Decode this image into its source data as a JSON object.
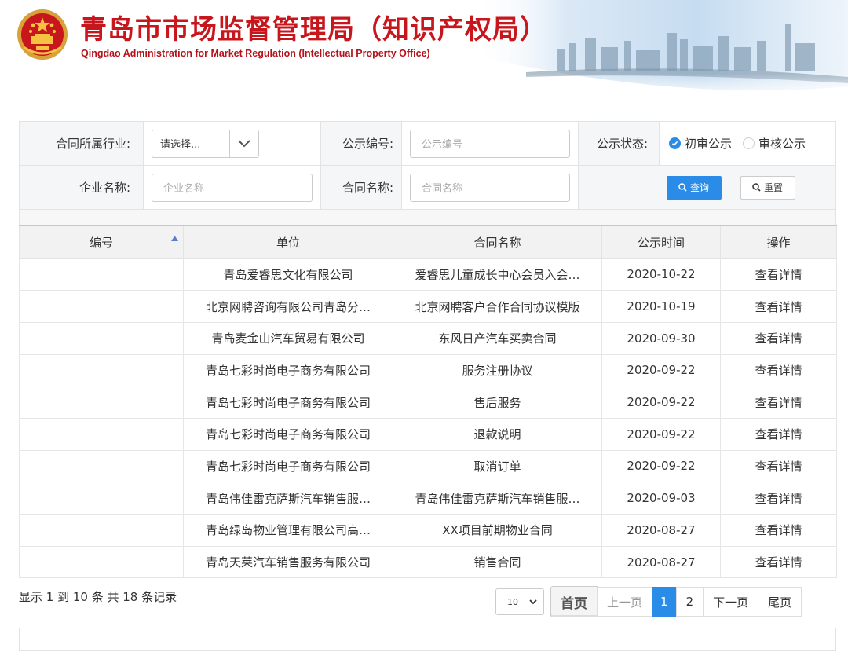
{
  "header": {
    "title_cn": "青岛市市场监督管理局（知识产权局）",
    "title_en": "Qingdao Administration for Market Regulation (Intellectual Property Office)",
    "emblem_icon": "national-emblem-icon"
  },
  "colors": {
    "brand_red": "#c8161d",
    "primary_blue": "#2a8ce6",
    "header_accent": "#f0c36d"
  },
  "search": {
    "industry_label": "合同所属行业:",
    "industry_select_value": "请选择...",
    "notice_no_label": "公示编号:",
    "notice_no_placeholder": "公示编号",
    "status_label": "公示状态:",
    "status_options": [
      {
        "label": "初审公示",
        "checked": true
      },
      {
        "label": "审核公示",
        "checked": false
      }
    ],
    "company_label": "企业名称:",
    "company_placeholder": "企业名称",
    "contract_label": "合同名称:",
    "contract_placeholder": "合同名称",
    "query_button": "查询",
    "reset_button": "重置"
  },
  "table": {
    "columns": [
      "编号",
      "单位",
      "合同名称",
      "公示时间",
      "操作"
    ],
    "rows": [
      {
        "id": "",
        "company": "青岛爱睿思文化有限公司",
        "contract": "爱睿思儿童成长中心会员入会…",
        "date": "2020-10-22",
        "action": "查看详情"
      },
      {
        "id": "",
        "company": "北京网聘咨询有限公司青岛分…",
        "contract": "北京网聘客户合作合同协议模版",
        "date": "2020-10-19",
        "action": "查看详情"
      },
      {
        "id": "",
        "company": "青岛麦金山汽车贸易有限公司",
        "contract": "东风日产汽车买卖合同",
        "date": "2020-09-30",
        "action": "查看详情"
      },
      {
        "id": "",
        "company": "青岛七彩时尚电子商务有限公司",
        "contract": "服务注册协议",
        "date": "2020-09-22",
        "action": "查看详情"
      },
      {
        "id": "",
        "company": "青岛七彩时尚电子商务有限公司",
        "contract": "售后服务",
        "date": "2020-09-22",
        "action": "查看详情"
      },
      {
        "id": "",
        "company": "青岛七彩时尚电子商务有限公司",
        "contract": "退款说明",
        "date": "2020-09-22",
        "action": "查看详情"
      },
      {
        "id": "",
        "company": "青岛七彩时尚电子商务有限公司",
        "contract": "取消订单",
        "date": "2020-09-22",
        "action": "查看详情"
      },
      {
        "id": "",
        "company": "青岛伟佳雷克萨斯汽车销售服…",
        "contract": "青岛伟佳雷克萨斯汽车销售服…",
        "date": "2020-09-03",
        "action": "查看详情"
      },
      {
        "id": "",
        "company": "青岛绿岛物业管理有限公司高…",
        "contract": "XX项目前期物业合同",
        "date": "2020-08-27",
        "action": "查看详情"
      },
      {
        "id": "",
        "company": "青岛天莱汽车销售服务有限公司",
        "contract": "销售合同",
        "date": "2020-08-27",
        "action": "查看详情"
      }
    ]
  },
  "footer": {
    "summary": "显示 1 到 10 条 共 18 条记录",
    "page_size": "10",
    "first": "首页",
    "prev": "上一页",
    "pages": [
      "1",
      "2"
    ],
    "current_page": "1",
    "next": "下一页",
    "last": "尾页"
  }
}
